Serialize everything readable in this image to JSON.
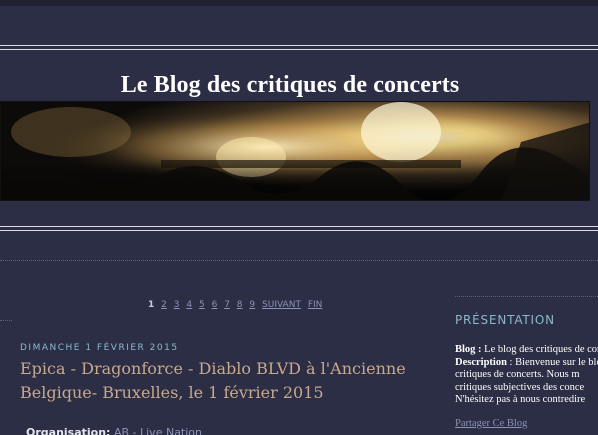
{
  "header": {
    "title": "Le Blog des critiques de concerts"
  },
  "pager": {
    "current": "1",
    "pages": [
      "2",
      "3",
      "4",
      "5",
      "6",
      "7",
      "8",
      "9"
    ],
    "next_label": "SUIVANT",
    "end_label": "FIN"
  },
  "post": {
    "date": "DIMANCHE 1 FÉVRIER 2015",
    "title": "Epica - Dragonforce - Diablo BLVD à l'Ancienne Belgique- Bruxelles, le 1 février 2015",
    "org_label": "Organisation:",
    "org_value": "AB - Live Nation"
  },
  "sidebar": {
    "heading": "PRÉSENTATION",
    "blog_label": "Blog :",
    "blog_value": "Le blog des critiques de concerts",
    "description_label": "Description",
    "description_lines": [
      ": Bienvenue sur le blog des",
      "critiques de concerts. Nous m",
      "critiques subjectives des conce",
      "N'hésitez pas à nous contredire"
    ],
    "share_link": "Partager Ce Blog"
  },
  "colors": {
    "background": "#2b2e45",
    "accent": "#8cb8cc",
    "title_post": "#c9a98d",
    "link": "#8a93b5"
  }
}
